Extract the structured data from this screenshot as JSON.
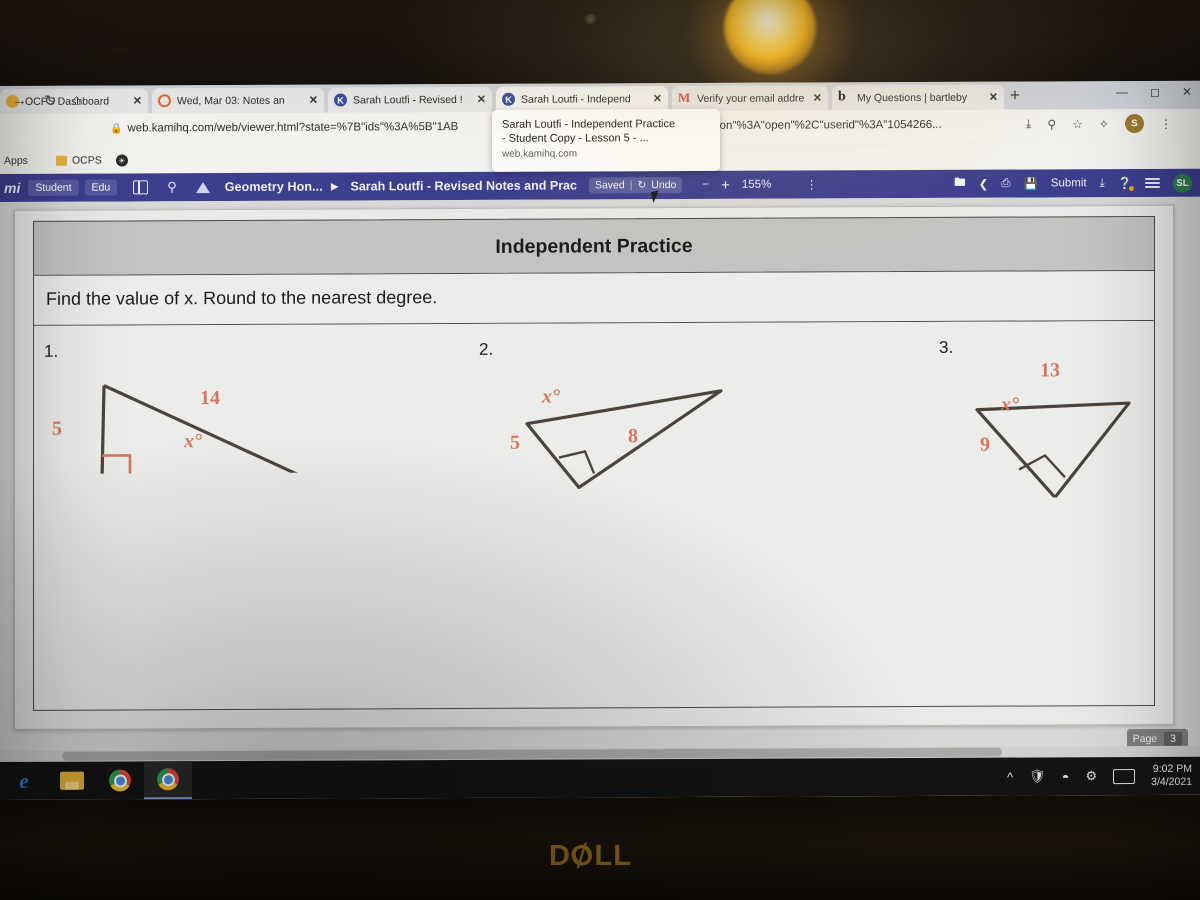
{
  "browser": {
    "tabs": [
      {
        "title": "OCPS Dashboard",
        "favicon": "square-icon",
        "active": false
      },
      {
        "title": "Wed, Mar 03: Notes an",
        "favicon": "circle-outline-icon",
        "active": false
      },
      {
        "title": "Sarah Loutfi - Revised !",
        "favicon": "kami-icon",
        "active": false
      },
      {
        "title": "Sarah Loutfi - Independ",
        "favicon": "kami-icon",
        "active": true
      },
      {
        "title": "Verify your email addre",
        "favicon": "gmail-icon",
        "active": false
      },
      {
        "title": "My Questions | bartleby",
        "favicon": "bartleby-icon",
        "active": false
      }
    ],
    "new_tab_label": "+",
    "window_buttons": [
      "minimize",
      "restore",
      "close"
    ],
    "nav": {
      "forward_icon": "arrow-right-icon",
      "reload_icon": "reload-icon",
      "home_icon": "home-icon",
      "lock_icon": "lock-icon",
      "url": "web.kamihq.com/web/viewer.html?state=%7B\"ids\"%3A%5B\"1AB",
      "url_tail": "0%2C\"action\"%3A\"open\"%2C\"userid\"%3A\"1054266...",
      "actions": [
        "install-icon",
        "zoom-icon",
        "bookmark-star-icon",
        "extensions-icon",
        "profile-avatar",
        "menu-dots-icon"
      ],
      "profile_initial": "S"
    },
    "bookmarks": [
      {
        "label": "Apps",
        "icon": "apps-icon"
      },
      {
        "label": "OCPS",
        "icon": "folder-icon"
      },
      {
        "label": "",
        "icon": "globe-icon"
      }
    ],
    "tooltip": {
      "line1": "Sarah Loutfi - Independent Practice",
      "line2": "- Student Copy - Lesson 5 - ...",
      "domain": "web.kamihq.com"
    }
  },
  "kami": {
    "logo": "mi",
    "chips": [
      "Student",
      "Edu"
    ],
    "split_view_icon": "split-view-icon",
    "search_icon": "search-icon",
    "drive_icon": "google-drive-icon",
    "folder_name": "Geometry Hon...",
    "breadcrumb_arrow": "chevron-right-icon",
    "document_title": "Sarah Loutfi - Revised Notes and Prac",
    "saved_label": "Saved",
    "undo_label": "Undo",
    "undo_icon": "undo-icon",
    "zoom_out": "−",
    "zoom_in": "+",
    "zoom_level": "155%",
    "zoom_stepper_icon": "stepper-icon",
    "right_icons": [
      {
        "name": "open-folder-icon"
      },
      {
        "name": "share-icon"
      },
      {
        "name": "print-icon"
      },
      {
        "name": "save-icon"
      }
    ],
    "submit_label": "Submit",
    "download_icon": "download-icon",
    "help_icon": "help-icon",
    "menu_icon": "hamburger-menu-icon",
    "avatar_initials": "SL"
  },
  "document": {
    "header_title": "Independent Practice",
    "instruction": "Find the value of x. Round to the nearest degree.",
    "problems": [
      {
        "number": "1.",
        "figure": "right-triangle",
        "labels": [
          {
            "text": "14",
            "role": "hypotenuse"
          },
          {
            "text": "5",
            "role": "leg"
          },
          {
            "text": "x°",
            "role": "angle"
          }
        ],
        "right_angle_marker": true
      },
      {
        "number": "2.",
        "figure": "obtuse-triangle",
        "labels": [
          {
            "text": "x°",
            "role": "angle"
          },
          {
            "text": "5",
            "role": "side"
          },
          {
            "text": "8",
            "role": "side"
          }
        ],
        "right_angle_marker": true
      },
      {
        "number": "3.",
        "figure": "inverted-triangle",
        "labels": [
          {
            "text": "13",
            "role": "side"
          },
          {
            "text": "x°",
            "role": "angle"
          },
          {
            "text": "9",
            "role": "side"
          }
        ],
        "right_angle_marker": true
      }
    ],
    "page_label": "Page",
    "page_number": "3",
    "label_color": "#d4775a"
  },
  "taskbar": {
    "apps": [
      {
        "name": "edge",
        "glyph": "e"
      },
      {
        "name": "file-explorer",
        "glyph": ""
      },
      {
        "name": "chrome",
        "glyph": ""
      },
      {
        "name": "chrome-active",
        "glyph": ""
      }
    ],
    "tray_icons": [
      "show-hidden-icons",
      "security-icon",
      "wifi-icon",
      "bluetooth-icon",
      "keyboard-icon"
    ],
    "time": "9:02 PM",
    "date": "3/4/2021"
  },
  "monitor": {
    "brand": "DELL"
  }
}
